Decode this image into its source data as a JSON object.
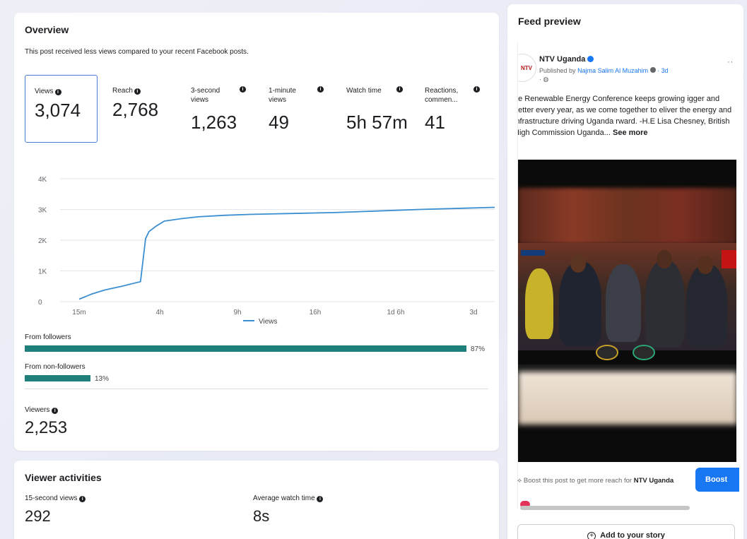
{
  "overview": {
    "title": "Overview",
    "subtitle": "This post received less views compared to your recent Facebook posts.",
    "metrics": [
      {
        "label": "Views",
        "value": "3,074"
      },
      {
        "label": "Reach",
        "value": "2,768"
      },
      {
        "label": "3-second views",
        "value": "1,263"
      },
      {
        "label": "1-minute views",
        "value": "49"
      },
      {
        "label": "Watch time",
        "value": "5h 57m"
      },
      {
        "label": "Reactions, commen...",
        "value": "41"
      }
    ],
    "from_followers": {
      "label": "From followers",
      "percent": 87,
      "percent_label": "87%"
    },
    "from_non_followers": {
      "label": "From non-followers",
      "percent": 13,
      "percent_label": "13%"
    },
    "viewers": {
      "label": "Viewers",
      "value": "2,253"
    }
  },
  "chart_data": {
    "type": "line",
    "x_tick_labels": [
      "15m",
      "4h",
      "9h",
      "16h",
      "1d 6h",
      "3d"
    ],
    "y_tick_labels": [
      "0",
      "1K",
      "2K",
      "3K",
      "4K"
    ],
    "ylim": [
      0,
      4000
    ],
    "grid": true,
    "legend_position": "bottom",
    "series": [
      {
        "name": "Views",
        "color": "#3b8fd1",
        "x": [
          0,
          0.15,
          0.3,
          0.5,
          0.72,
          0.78,
          0.82,
          0.9,
          1.0,
          1.2,
          1.4,
          1.7,
          2.0,
          2.5,
          3.0,
          3.5,
          4.0,
          4.5,
          5.0
        ],
        "values": [
          80,
          250,
          380,
          500,
          650,
          2050,
          2280,
          2450,
          2620,
          2700,
          2760,
          2810,
          2840,
          2870,
          2900,
          2950,
          3000,
          3040,
          3074
        ]
      }
    ]
  },
  "viewer_activities": {
    "title": "Viewer activities",
    "items": [
      {
        "label": "15-second views",
        "value": "292"
      },
      {
        "label": "Average watch time",
        "value": "8s"
      }
    ]
  },
  "feed": {
    "title": "Feed preview",
    "logo_text": "NTV",
    "page_name": "NTV Uganda",
    "published_prefix": "Published by",
    "author": "Najma Salim Al Muzahim",
    "time": "· 3d",
    "post_text": "ne Renewable Energy Conference keeps growing igger and better every year, as we come together to eliver the energy and infrastructure driving Uganda rward. -H.E Lisa Chesney, British High Commission Uganda...",
    "see_more": "See more",
    "boost_text_prefix": "Boost this post to get more reach for",
    "boost_page": "NTV Uganda",
    "boost_button": "Boost",
    "add_story": "Add to your story"
  },
  "colors": {
    "accent": "#1877f2",
    "bar": "#1e7f7b",
    "line": "#3b8fd1"
  }
}
